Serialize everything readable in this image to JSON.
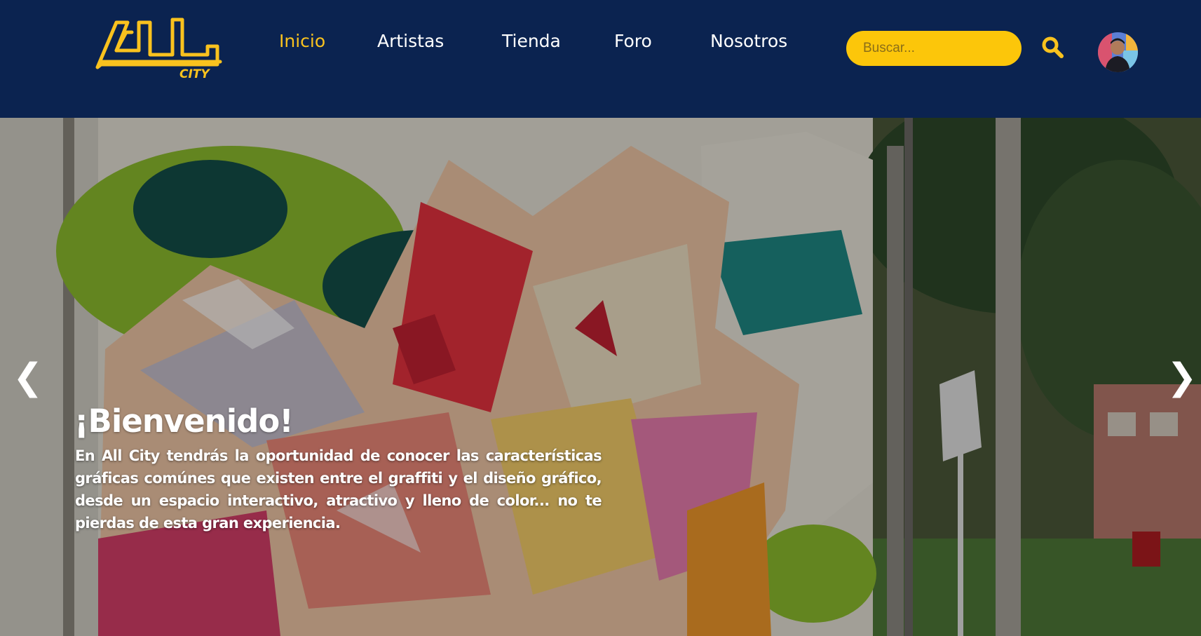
{
  "brand": {
    "logo_text": "CITY",
    "logo_color": "#f9c21e"
  },
  "nav": {
    "items": [
      {
        "label": "Inicio",
        "active": true
      },
      {
        "label": "Artistas",
        "active": false
      },
      {
        "label": "Tienda",
        "active": false
      },
      {
        "label": "Foro",
        "active": false
      },
      {
        "label": "Nosotros",
        "active": false
      }
    ]
  },
  "search": {
    "placeholder": "Buscar...",
    "icon": "search-icon"
  },
  "user": {
    "avatar_icon": "user-avatar"
  },
  "hero": {
    "title": "¡Bienvenido!",
    "text": "En All City tendrás la oportunidad de conocer las características gráficas comúnes que existen entre el graffiti y el diseño gráfico, desde un espacio interactivo, atractivo y lleno de color... no te pierdas de esta gran experiencia.",
    "prev_icon": "chevron-left-icon",
    "prev_glyph": "❮",
    "next_icon": "chevron-right-icon",
    "next_glyph": "❯"
  },
  "colors": {
    "header_bg": "#0b2350",
    "accent": "#f9c21e",
    "search_bg": "#fcc60a"
  }
}
